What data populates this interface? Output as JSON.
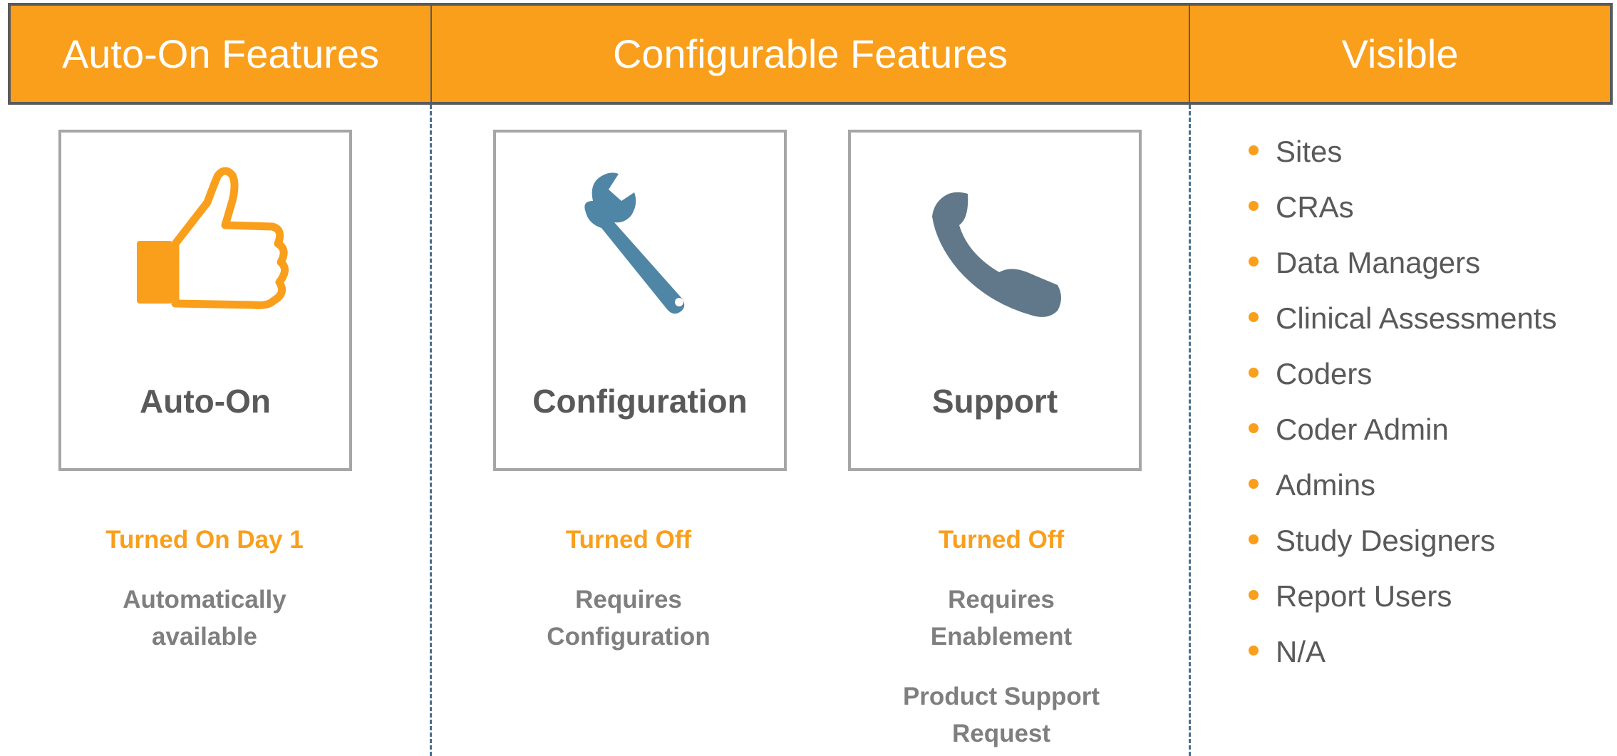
{
  "headers": {
    "auto_on": "Auto-On Features",
    "configurable": "Configurable Features",
    "visible": "Visible"
  },
  "cards": {
    "auto_on": {
      "title": "Auto-On",
      "icon": "thumbs-up-icon"
    },
    "configuration": {
      "title": "Configuration",
      "icon": "wrench-icon"
    },
    "support": {
      "title": "Support",
      "icon": "phone-icon"
    }
  },
  "status": {
    "auto_on": "Turned On Day 1",
    "configuration": "Turned Off",
    "support": "Turned Off"
  },
  "descriptions": {
    "auto_on": [
      "Automatically",
      "available"
    ],
    "configuration": [
      "Requires",
      "Configuration"
    ],
    "support": [
      "Requires",
      "Enablement"
    ],
    "support_request": [
      "Product Support",
      "Request"
    ]
  },
  "visible_list": [
    "Sites",
    "CRAs",
    "Data Managers",
    "Clinical Assessments",
    "Coders",
    "Coder Admin",
    "Admins",
    "Study Designers",
    "Report Users",
    "N/A"
  ],
  "colors": {
    "accent": "#f99f1c",
    "header_border": "#5a5a5a",
    "wrench": "#4f86a6",
    "phone": "#607889",
    "divider": "#4a6f8d"
  }
}
